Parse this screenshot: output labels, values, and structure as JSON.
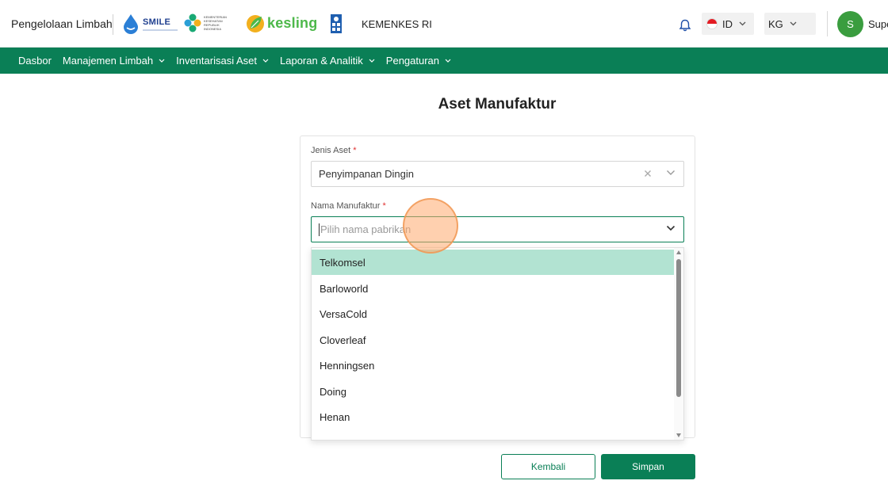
{
  "header": {
    "app_title": "Pengelolaan Limbah",
    "logos": {
      "smile": "SMILE",
      "kemenkes_small": "KEMENTERIAN KESEHATAN REPUBLIK INDONESIA",
      "kesling": "kesling"
    },
    "org_name": "KEMENKES RI",
    "language": "ID",
    "unit": "KG",
    "avatar_initial": "S",
    "username": "Supe"
  },
  "nav": {
    "items": [
      {
        "label": "Dasbor",
        "has_menu": false
      },
      {
        "label": "Manajemen Limbah",
        "has_menu": true
      },
      {
        "label": "Inventarisasi Aset",
        "has_menu": true
      },
      {
        "label": "Laporan & Analitik",
        "has_menu": true
      },
      {
        "label": "Pengaturan",
        "has_menu": true
      }
    ]
  },
  "page": {
    "title": "Aset Manufaktur"
  },
  "form": {
    "asset_type": {
      "label": "Jenis Aset",
      "required_mark": "*",
      "value": "Penyimpanan Dingin"
    },
    "manufacturer": {
      "label": "Nama Manufaktur",
      "required_mark": "*",
      "placeholder": "Pilih nama pabrikan"
    }
  },
  "dropdown": {
    "options": [
      "Telkomsel",
      "Barloworld",
      "VersaCold",
      "Cloverleaf",
      "Henningsen",
      "Doing",
      "Henan"
    ],
    "active_index": 0
  },
  "buttons": {
    "back": "Kembali",
    "save": "Simpan"
  },
  "colors": {
    "primary": "#0a7f56",
    "active_option": "#b2e3d2",
    "avatar": "#3a9d3f",
    "required": "#e03131"
  }
}
